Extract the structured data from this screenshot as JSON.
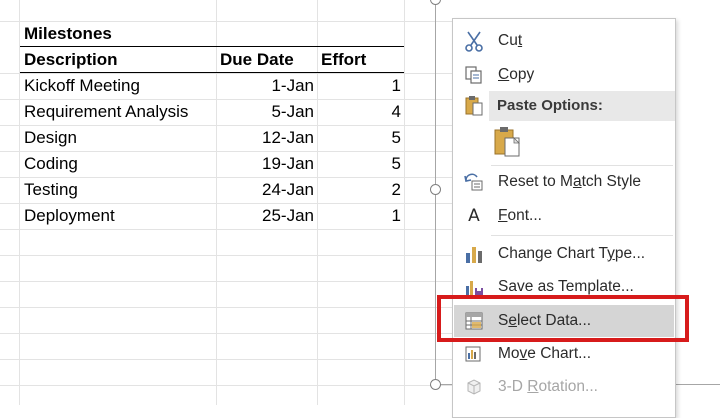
{
  "sheet": {
    "title": "Milestones",
    "headers": {
      "description": "Description",
      "due": "Due Date",
      "effort": "Effort"
    },
    "rows": [
      {
        "description": "Kickoff Meeting",
        "due": "1-Jan",
        "effort": "1"
      },
      {
        "description": "Requirement Analysis",
        "due": "5-Jan",
        "effort": "4"
      },
      {
        "description": "Design",
        "due": "12-Jan",
        "effort": "5"
      },
      {
        "description": "Coding",
        "due": "19-Jan",
        "effort": "5"
      },
      {
        "description": "Testing",
        "due": "24-Jan",
        "effort": "2"
      },
      {
        "description": "Deployment",
        "due": "25-Jan",
        "effort": "1"
      }
    ]
  },
  "menu": {
    "cut": {
      "pre": "Cu",
      "acc": "t",
      "post": ""
    },
    "copy": {
      "pre": "",
      "acc": "C",
      "post": "opy"
    },
    "paste_options": "Paste Options:",
    "reset": {
      "pre": "Reset to M",
      "acc": "a",
      "post": "tch Style"
    },
    "font": {
      "pre": "",
      "acc": "F",
      "post": "ont..."
    },
    "change_chart_type": {
      "pre": "Change Chart T",
      "acc": "y",
      "post": "pe..."
    },
    "save_template": {
      "pre": "Save as Template...",
      "acc": "",
      "post": ""
    },
    "select_data": {
      "pre": "S",
      "acc": "e",
      "post": "lect Data..."
    },
    "move_chart": {
      "pre": "Mo",
      "acc": "v",
      "post": "e Chart..."
    },
    "rotation": {
      "pre": "3-D ",
      "acc": "R",
      "post": "otation..."
    }
  },
  "colors": {
    "highlight_box": "#d71b1b",
    "hover_item": "#d5d5d5",
    "paste_header": "#e8e8e8"
  }
}
